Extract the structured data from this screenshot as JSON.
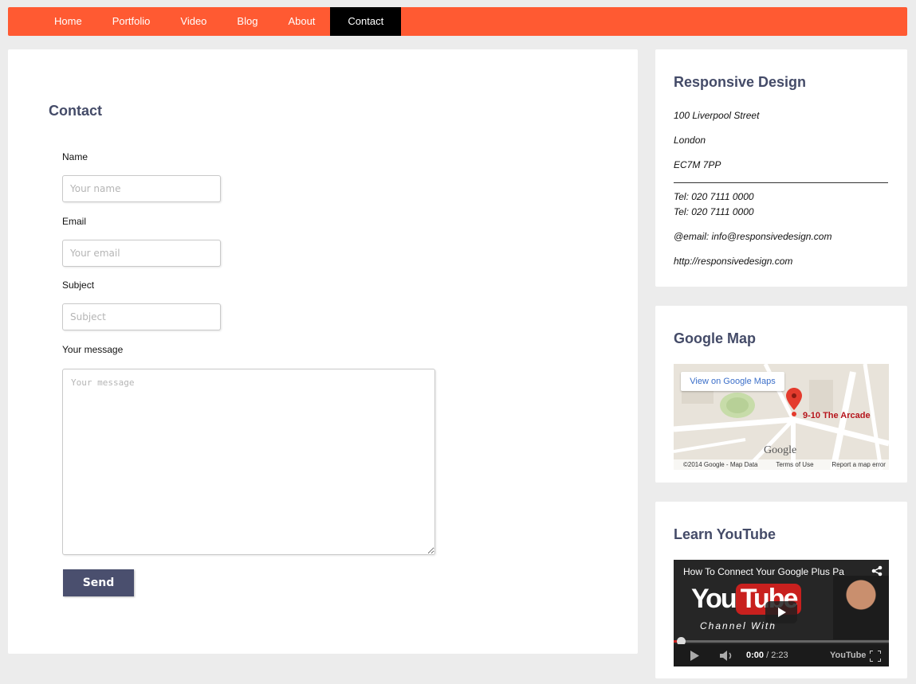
{
  "nav": {
    "items": [
      {
        "label": "Home"
      },
      {
        "label": "Portfolio"
      },
      {
        "label": "Video"
      },
      {
        "label": "Blog"
      },
      {
        "label": "About"
      },
      {
        "label": "Contact"
      }
    ],
    "active": "Contact",
    "color": "#ff5a32"
  },
  "contact": {
    "title": "Contact",
    "name_label": "Name",
    "name_placeholder": "Your name",
    "email_label": "Email",
    "email_placeholder": "Your email",
    "subject_label": "Subject",
    "subject_placeholder": "Subject",
    "message_label": "Your message",
    "message_placeholder": "Your message",
    "send_label": "Send"
  },
  "responsive": {
    "title": "Responsive Design",
    "address1": "100 Liverpool Street",
    "address2": "London",
    "postcode": "EC7M 7PP",
    "tel1": "Tel: 020 7111 0000",
    "tel2": "Tel: 020 7111 0000",
    "email": "@email: info@responsivedesign.com",
    "website": "http://responsivedesign.com"
  },
  "map": {
    "title": "Google Map",
    "view_link": "View on Google Maps",
    "pin_label": "9-10 The Arcade",
    "brand": "Google",
    "copyright": "©2014 Google - Map Data",
    "terms": "Terms of Use",
    "report": "Report a map error"
  },
  "youtube": {
    "title": "Learn YouTube",
    "video_title": "How To Connect Your Google Plus Pa",
    "logo_you": "You",
    "logo_tube": "Tube",
    "channel_text": "Channel With",
    "time_current": "0:00",
    "time_total": "/ 2:23",
    "brand": "YouTube"
  }
}
